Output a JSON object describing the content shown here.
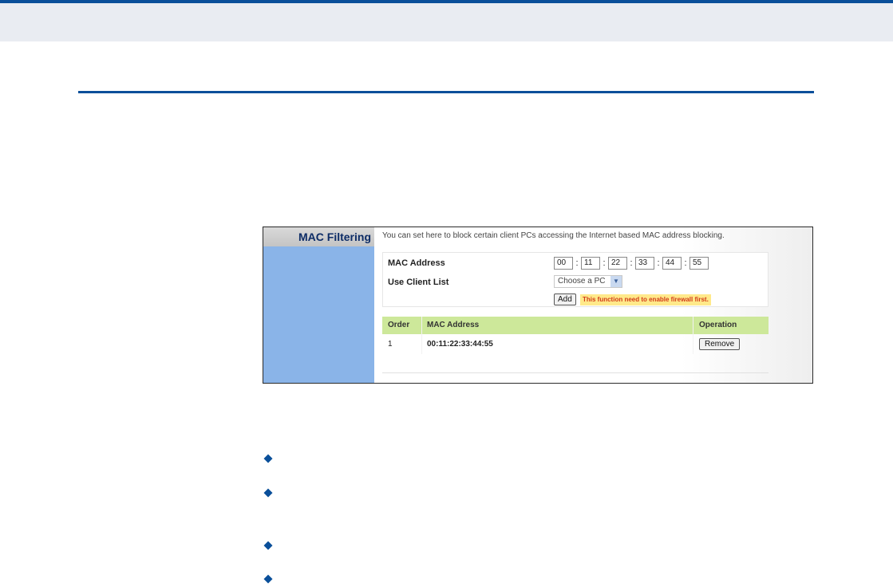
{
  "panel": {
    "side_title": "MAC Filtering",
    "description": "You can set here to block certain client PCs accessing the Internet based MAC address blocking.",
    "mac_label": "MAC Address",
    "mac_octets": [
      "00",
      "11",
      "22",
      "33",
      "44",
      "55"
    ],
    "client_label": "Use Client List",
    "client_select": "Choose a PC",
    "add_label": "Add",
    "warning": "This function need to enable firewall first."
  },
  "table": {
    "headers": {
      "order": "Order",
      "mac": "MAC Address",
      "operation": "Operation"
    },
    "rows": [
      {
        "order": "1",
        "mac": "00:11:22:33:44:55",
        "action": "Remove"
      }
    ]
  },
  "colors": {
    "brand": "#0a4f9a",
    "side_panel": "#8ab4e8",
    "table_header": "#cde89a",
    "warning_bg": "#ffe98a"
  },
  "bullets": {
    "count": 4,
    "icon": "diamond-bullet-icon"
  }
}
